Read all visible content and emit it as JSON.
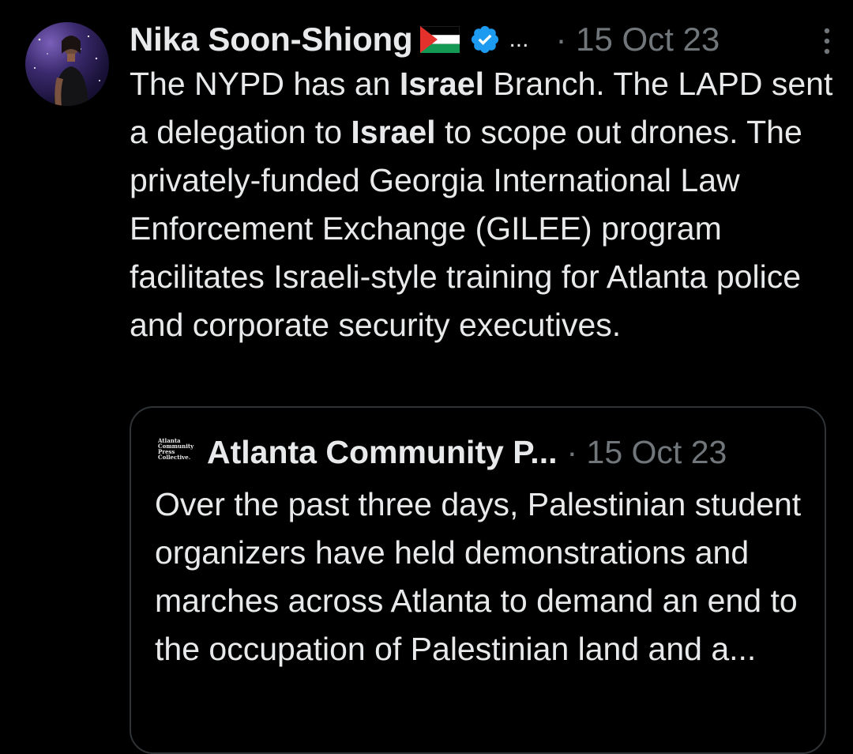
{
  "colors": {
    "background": "#000000",
    "text_primary": "#e7e9ea",
    "text_secondary": "#71767b",
    "verified_blue": "#1d9bf0",
    "card_border": "#2f3336"
  },
  "tweet": {
    "author": {
      "display_name": "Nika Soon-Shiong",
      "flag_icon": "palestine-flag-icon",
      "verified_icon": "verified-badge-icon",
      "name_overflow": "..."
    },
    "meta": "· 15 Oct 23",
    "more_icon": "more-vertical-icon",
    "text_parts": [
      {
        "text": "The NYPD has an ",
        "bold": false
      },
      {
        "text": "Israel",
        "bold": true
      },
      {
        "text": " Branch. The LAPD sent a delegation to ",
        "bold": false
      },
      {
        "text": "Israel",
        "bold": true
      },
      {
        "text": " to scope out drones. The privately-funded Georgia International Law Enforcement Exchange (GILEE) program facilitates Israeli-style training for Atlanta police and corporate security executives.",
        "bold": false
      }
    ]
  },
  "quote": {
    "logo_text": [
      "Atlanta",
      "Community",
      "Press",
      "Collective."
    ],
    "author_name": "Atlanta Community P...",
    "meta": "· 15 Oct 23",
    "text": "Over the past three days, Palestinian student organizers have held demonstrations and marches across Atlanta to demand an end to the occupation of Palestinian land and a..."
  }
}
